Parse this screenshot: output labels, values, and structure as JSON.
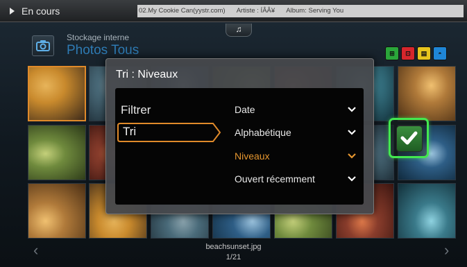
{
  "topbar": {
    "now_playing": "En cours",
    "track": "02.My Cookie Can(yystr.com)",
    "artist": "Artiste : ÍÂÂ¥",
    "album": "Album: Serving You"
  },
  "header": {
    "music_tab_icon": "music-note-icon",
    "storage": "Stockage interne",
    "title": "Photos  Tous",
    "color_buttons": [
      {
        "label": "⊞",
        "color": "#2aa63a"
      },
      {
        "label": "⊡",
        "color": "#d6262c"
      },
      {
        "label": "▤",
        "color": "#e7c51d"
      },
      {
        "label": "◓",
        "color": "#1f86d6"
      }
    ]
  },
  "dialog": {
    "title": "Tri : Niveaux",
    "left_items": [
      "Filtrer",
      "Tri"
    ],
    "selected_left": "Tri",
    "options": [
      {
        "label": "Date",
        "active": false
      },
      {
        "label": "Alphabétique",
        "active": false
      },
      {
        "label": "Niveaux",
        "active": true
      },
      {
        "label": "Ouvert récemment",
        "active": false
      }
    ]
  },
  "footer": {
    "filename": "beachsunset.jpg",
    "counter": "1/21"
  },
  "colors": {
    "accent_orange": "#e08a2a",
    "confirm_green": "#43e84f",
    "title_blue": "#2e7bb4"
  }
}
